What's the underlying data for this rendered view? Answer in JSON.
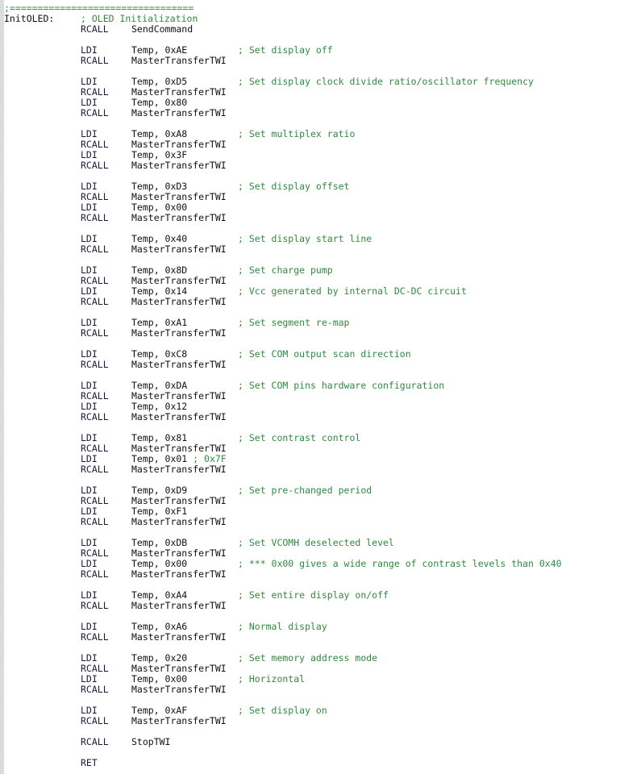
{
  "window": {
    "title": "OLED Initialization Assembly Listing",
    "background_color": "#ffffff",
    "gutter_color": "#b9b9b9"
  },
  "colors": {
    "comment": "#2e8b3d",
    "mnemonic": "#1a1a3c",
    "operand": "#101018",
    "label": "#101018",
    "background": "#ffffff"
  },
  "code": {
    "language": "AVR Assembly",
    "lines": [
      {
        "kind": "comment",
        "text": ";================================="
      },
      {
        "kind": "label",
        "label": "InitOLED:",
        "comment": "; OLED Initialization"
      },
      {
        "kind": "instruction",
        "label": "",
        "mnemonic": "RCALL",
        "operand": "SendCommand",
        "comment": ""
      },
      {
        "kind": "blank"
      },
      {
        "kind": "instruction",
        "label": "",
        "mnemonic": "LDI",
        "operand": "Temp, 0xAE",
        "comment": "; Set display off"
      },
      {
        "kind": "instruction",
        "label": "",
        "mnemonic": "RCALL",
        "operand": "MasterTransferTWI",
        "comment": ""
      },
      {
        "kind": "blank"
      },
      {
        "kind": "instruction",
        "label": "",
        "mnemonic": "LDI",
        "operand": "Temp, 0xD5",
        "comment": "; Set display clock divide ratio/oscillator frequency"
      },
      {
        "kind": "instruction",
        "label": "",
        "mnemonic": "RCALL",
        "operand": "MasterTransferTWI",
        "comment": ""
      },
      {
        "kind": "instruction",
        "label": "",
        "mnemonic": "LDI",
        "operand": "Temp, 0x80",
        "comment": ""
      },
      {
        "kind": "instruction",
        "label": "",
        "mnemonic": "RCALL",
        "operand": "MasterTransferTWI",
        "comment": ""
      },
      {
        "kind": "blank"
      },
      {
        "kind": "instruction",
        "label": "",
        "mnemonic": "LDI",
        "operand": "Temp, 0xA8",
        "comment": "; Set multiplex ratio"
      },
      {
        "kind": "instruction",
        "label": "",
        "mnemonic": "RCALL",
        "operand": "MasterTransferTWI",
        "comment": ""
      },
      {
        "kind": "instruction",
        "label": "",
        "mnemonic": "LDI",
        "operand": "Temp, 0x3F",
        "comment": ""
      },
      {
        "kind": "instruction",
        "label": "",
        "mnemonic": "RCALL",
        "operand": "MasterTransferTWI",
        "comment": ""
      },
      {
        "kind": "blank"
      },
      {
        "kind": "instruction",
        "label": "",
        "mnemonic": "LDI",
        "operand": "Temp, 0xD3",
        "comment": "; Set display offset"
      },
      {
        "kind": "instruction",
        "label": "",
        "mnemonic": "RCALL",
        "operand": "MasterTransferTWI",
        "comment": ""
      },
      {
        "kind": "instruction",
        "label": "",
        "mnemonic": "LDI",
        "operand": "Temp, 0x00",
        "comment": ""
      },
      {
        "kind": "instruction",
        "label": "",
        "mnemonic": "RCALL",
        "operand": "MasterTransferTWI",
        "comment": ""
      },
      {
        "kind": "blank"
      },
      {
        "kind": "instruction",
        "label": "",
        "mnemonic": "LDI",
        "operand": "Temp, 0x40",
        "comment": "; Set display start line"
      },
      {
        "kind": "instruction",
        "label": "",
        "mnemonic": "RCALL",
        "operand": "MasterTransferTWI",
        "comment": ""
      },
      {
        "kind": "blank"
      },
      {
        "kind": "instruction",
        "label": "",
        "mnemonic": "LDI",
        "operand": "Temp, 0x8D",
        "comment": "; Set charge pump"
      },
      {
        "kind": "instruction",
        "label": "",
        "mnemonic": "RCALL",
        "operand": "MasterTransferTWI",
        "comment": ""
      },
      {
        "kind": "instruction",
        "label": "",
        "mnemonic": "LDI",
        "operand": "Temp, 0x14",
        "comment": "; Vcc generated by internal DC-DC circuit"
      },
      {
        "kind": "instruction",
        "label": "",
        "mnemonic": "RCALL",
        "operand": "MasterTransferTWI",
        "comment": ""
      },
      {
        "kind": "blank"
      },
      {
        "kind": "instruction",
        "label": "",
        "mnemonic": "LDI",
        "operand": "Temp, 0xA1",
        "comment": "; Set segment re-map"
      },
      {
        "kind": "instruction",
        "label": "",
        "mnemonic": "RCALL",
        "operand": "MasterTransferTWI",
        "comment": ""
      },
      {
        "kind": "blank"
      },
      {
        "kind": "instruction",
        "label": "",
        "mnemonic": "LDI",
        "operand": "Temp, 0xC8",
        "comment": "; Set COM output scan direction"
      },
      {
        "kind": "instruction",
        "label": "",
        "mnemonic": "RCALL",
        "operand": "MasterTransferTWI",
        "comment": ""
      },
      {
        "kind": "blank"
      },
      {
        "kind": "instruction",
        "label": "",
        "mnemonic": "LDI",
        "operand": "Temp, 0xDA",
        "comment": "; Set COM pins hardware configuration"
      },
      {
        "kind": "instruction",
        "label": "",
        "mnemonic": "RCALL",
        "operand": "MasterTransferTWI",
        "comment": ""
      },
      {
        "kind": "instruction",
        "label": "",
        "mnemonic": "LDI",
        "operand": "Temp, 0x12",
        "comment": ""
      },
      {
        "kind": "instruction",
        "label": "",
        "mnemonic": "RCALL",
        "operand": "MasterTransferTWI",
        "comment": ""
      },
      {
        "kind": "blank"
      },
      {
        "kind": "instruction",
        "label": "",
        "mnemonic": "LDI",
        "operand": "Temp, 0x81",
        "comment": "; Set contrast control"
      },
      {
        "kind": "instruction",
        "label": "",
        "mnemonic": "RCALL",
        "operand": "MasterTransferTWI",
        "comment": ""
      },
      {
        "kind": "instruction-inline",
        "label": "",
        "mnemonic": "LDI",
        "operand": "Temp, 0x01 ",
        "comment": "; 0x7F"
      },
      {
        "kind": "instruction",
        "label": "",
        "mnemonic": "RCALL",
        "operand": "MasterTransferTWI",
        "comment": ""
      },
      {
        "kind": "blank"
      },
      {
        "kind": "instruction",
        "label": "",
        "mnemonic": "LDI",
        "operand": "Temp, 0xD9",
        "comment": "; Set pre-changed period"
      },
      {
        "kind": "instruction",
        "label": "",
        "mnemonic": "RCALL",
        "operand": "MasterTransferTWI",
        "comment": ""
      },
      {
        "kind": "instruction",
        "label": "",
        "mnemonic": "LDI",
        "operand": "Temp, 0xF1",
        "comment": ""
      },
      {
        "kind": "instruction",
        "label": "",
        "mnemonic": "RCALL",
        "operand": "MasterTransferTWI",
        "comment": ""
      },
      {
        "kind": "blank"
      },
      {
        "kind": "instruction",
        "label": "",
        "mnemonic": "LDI",
        "operand": "Temp, 0xDB",
        "comment": "; Set VCOMH deselected level"
      },
      {
        "kind": "instruction",
        "label": "",
        "mnemonic": "RCALL",
        "operand": "MasterTransferTWI",
        "comment": ""
      },
      {
        "kind": "instruction",
        "label": "",
        "mnemonic": "LDI",
        "operand": "Temp, 0x00",
        "comment": "; *** 0x00 gives a wide range of contrast levels than 0x40"
      },
      {
        "kind": "instruction",
        "label": "",
        "mnemonic": "RCALL",
        "operand": "MasterTransferTWI",
        "comment": ""
      },
      {
        "kind": "blank"
      },
      {
        "kind": "instruction",
        "label": "",
        "mnemonic": "LDI",
        "operand": "Temp, 0xA4",
        "comment": "; Set entire display on/off"
      },
      {
        "kind": "instruction",
        "label": "",
        "mnemonic": "RCALL",
        "operand": "MasterTransferTWI",
        "comment": ""
      },
      {
        "kind": "blank"
      },
      {
        "kind": "instruction",
        "label": "",
        "mnemonic": "LDI",
        "operand": "Temp, 0xA6",
        "comment": "; Normal display"
      },
      {
        "kind": "instruction",
        "label": "",
        "mnemonic": "RCALL",
        "operand": "MasterTransferTWI",
        "comment": ""
      },
      {
        "kind": "blank"
      },
      {
        "kind": "instruction",
        "label": "",
        "mnemonic": "LDI",
        "operand": "Temp, 0x20",
        "comment": "; Set memory address mode"
      },
      {
        "kind": "instruction",
        "label": "",
        "mnemonic": "RCALL",
        "operand": "MasterTransferTWI",
        "comment": ""
      },
      {
        "kind": "instruction",
        "label": "",
        "mnemonic": "LDI",
        "operand": "Temp, 0x00",
        "comment": "; Horizontal"
      },
      {
        "kind": "instruction",
        "label": "",
        "mnemonic": "RCALL",
        "operand": "MasterTransferTWI",
        "comment": ""
      },
      {
        "kind": "blank"
      },
      {
        "kind": "instruction",
        "label": "",
        "mnemonic": "LDI",
        "operand": "Temp, 0xAF",
        "comment": "; Set display on"
      },
      {
        "kind": "instruction",
        "label": "",
        "mnemonic": "RCALL",
        "operand": "MasterTransferTWI",
        "comment": ""
      },
      {
        "kind": "blank"
      },
      {
        "kind": "instruction",
        "label": "",
        "mnemonic": "RCALL",
        "operand": "StopTWI",
        "comment": ""
      },
      {
        "kind": "blank"
      },
      {
        "kind": "instruction",
        "label": "",
        "mnemonic": "RET",
        "operand": "",
        "comment": ""
      }
    ]
  }
}
